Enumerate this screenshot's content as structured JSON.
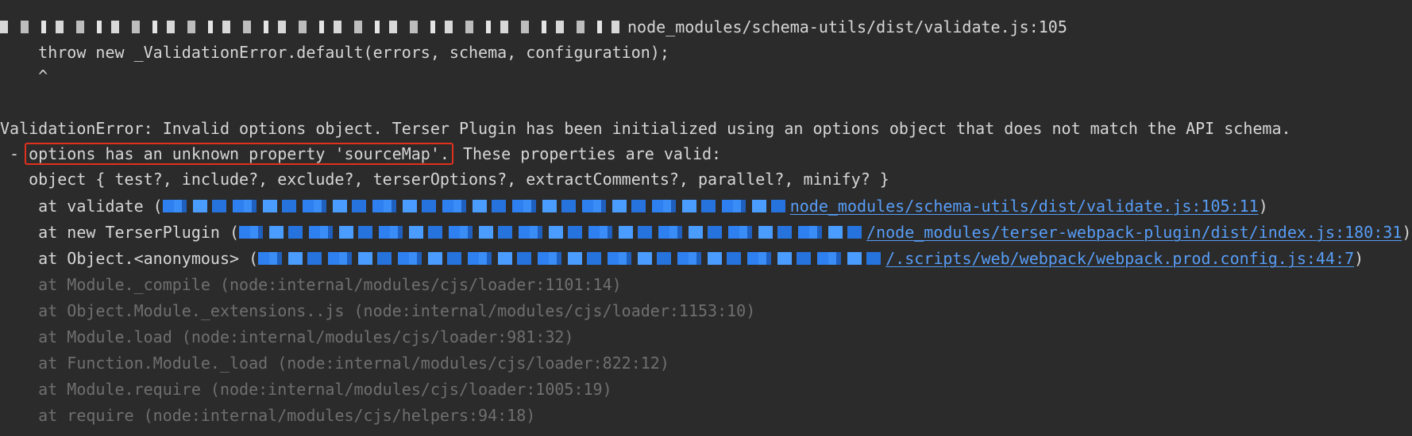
{
  "console": {
    "line1": "node_modules/schema-utils/dist/validate.js:105",
    "line2": "    throw new _ValidationError.default(errors, schema, configuration);",
    "line3": "    ^",
    "error_header": "ValidationError: Invalid options object. Terser Plugin has been initialized using an options object that does not match the API schema.",
    "bullet_prefix": " - ",
    "highlight_text": "options has an unknown property 'sourceMap'.",
    "bullet_rest": " These properties are valid:",
    "schema_line": "   object { test?, include?, exclude?, terserOptions?, extractComments?, parallel?, minify? }",
    "frames": [
      {
        "prefix": "    at validate (",
        "link": "node_modules/schema-utils/dist/validate.js:105:11",
        "suffix": ")"
      },
      {
        "prefix": "    at new TerserPlugin (",
        "link": "/node_modules/terser-webpack-plugin/dist/index.js:180:31",
        "suffix": ")"
      },
      {
        "prefix": "    at Object.<anonymous> (",
        "link": "/.scripts/web/webpack/webpack.prod.config.js:44:7",
        "suffix": ")"
      }
    ],
    "internal_frames": [
      "    at Module._compile (node:internal/modules/cjs/loader:1101:14)",
      "    at Object.Module._extensions..js (node:internal/modules/cjs/loader:1153:10)",
      "    at Module.load (node:internal/modules/cjs/loader:981:32)",
      "    at Function.Module._load (node:internal/modules/cjs/loader:822:12)",
      "    at Module.require (node:internal/modules/cjs/loader:1005:19)",
      "    at require (node:internal/modules/cjs/helpers:94:18)"
    ]
  },
  "colors": {
    "background": "#2b2b2b",
    "text": "#d6d6d6",
    "link": "#589df6",
    "dim": "#6f6f6f",
    "highlight_border": "#e0301e"
  }
}
